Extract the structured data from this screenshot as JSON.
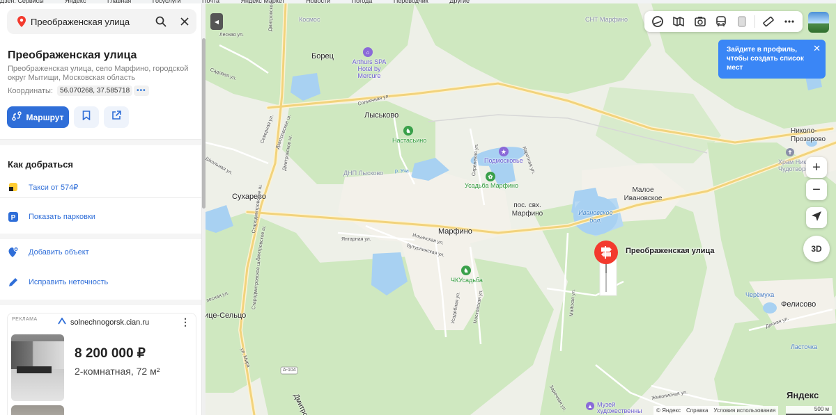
{
  "bookmarks": [
    "Дзен: Сервисы",
    "Яндекс",
    "Главная",
    "Госуслуги",
    "Почта",
    "Яндекс Маркет",
    "Новости",
    "Погода",
    "Переводчик",
    "Другие"
  ],
  "search": {
    "query": "Преображенская улица"
  },
  "place": {
    "title": "Преображенская улица",
    "address": "Преображенская улица, село Марфино, городской округ Мытищи, Московская область",
    "coords_label": "Координаты:",
    "coords_value": "56.070268, 37.585718",
    "coords_more": "•••"
  },
  "actions": {
    "route_label": "Маршрут"
  },
  "directions": {
    "title": "Как добраться",
    "taxi": "Такси от 574₽",
    "parking": "Показать парковки",
    "add_object": "Добавить объект",
    "fix_error": "Исправить неточность"
  },
  "ad": {
    "label": "РЕКЛАМА",
    "domain": "solnechnogorsk.cian.ru",
    "price": "8 200 000 ₽",
    "desc": "2-комнатная, 72 м²"
  },
  "tooltip": {
    "text": "Зайдите в профиль, чтобы создать список мест",
    "close": "✕"
  },
  "controls": {
    "zoom_in": "+",
    "zoom_out": "−",
    "three_d": "3D"
  },
  "marker": {
    "label": "Преображенская улица"
  },
  "map_labels": {
    "borets": "Борец",
    "kosmos": "Космос",
    "arthurs": "Arthurs SPA Hotel by Mercure",
    "lyskovo": "Лыськово",
    "nastasino": "Настасьино",
    "podmoskovie": "Подмосковье",
    "usadba_marfino": "Усадьба Марфино",
    "dnp_lyskovo": "ДНП Лысково",
    "suharevo": "Сухарево",
    "marfino": "Марфино",
    "pos_marfino": "пос. свх. Марфино",
    "maloe_ivanovskoe": "Малое Ивановское",
    "ivanovskoe_bol": "Ивановское бол.",
    "nikolo_prozorovo": "Николо-Прозорово",
    "hram": "Храм Никол. Чудотворц",
    "chk_usadba": "ЧКУсадьба",
    "felisovo": "Фелисово",
    "cheremukha": "Черёмуха",
    "lastochka": "Ласточка",
    "ice_seltso": "ице-Сельцо",
    "sht_marfino": "СНТ Марфино",
    "a104": "А-104",
    "muzei": "Музей художественны",
    "dmitrovskoe1": "Дмитровское ш.",
    "dmitrovskoe2": "Дмитровское ш.",
    "dmitrovskoe3": "Дмитровское ш.",
    "dmitrovskoe4": "Дмитровское ш.",
    "dmitrov_bottom": "Дмитров",
    "staro_dmitr": "Стародмитровское ш.",
    "staro_dmitr2": "Стародмитровское ш.",
    "lesnaya": "Лесная ул.",
    "sadovaya": "Садовая ул.",
    "severnaya": "Северная ул.",
    "shkolnaya": "Школьная ул.",
    "solnechnaya": "Солнечная ул.",
    "r_ucha": "р. Уча",
    "yantarnaya": "Янтарная ул.",
    "ilinskaya": "Ильинская ул.",
    "buturlinskaya": "Бутурлинская ул.",
    "usadebnaya": "Усадебная ул.",
    "moskovskaya": "Московская ул.",
    "maiskaya": "Майская ул.",
    "karetnaya": "Каретная ул.",
    "sirenevaya": "Сиреневая ул.",
    "ul_mira": "ул. Мира",
    "dachnaya": "Дачная ул.",
    "zhivopisnaya": "Живописная ул.",
    "zarechnaya": "Заречная ул.",
    "lesnaya2": "лесная ул."
  },
  "attribution": {
    "copy": "© Яндекс",
    "help": "Справка",
    "terms": "Условия использования",
    "scale": "500 м"
  },
  "logo": "Яндекс",
  "colors": {
    "accent": "#2f6ed8",
    "marker": "#f33a2e",
    "tooltip": "#3a86f6",
    "forest": "#cfe8c0",
    "water": "#a8d1f2",
    "road": "#f7e6a8"
  }
}
